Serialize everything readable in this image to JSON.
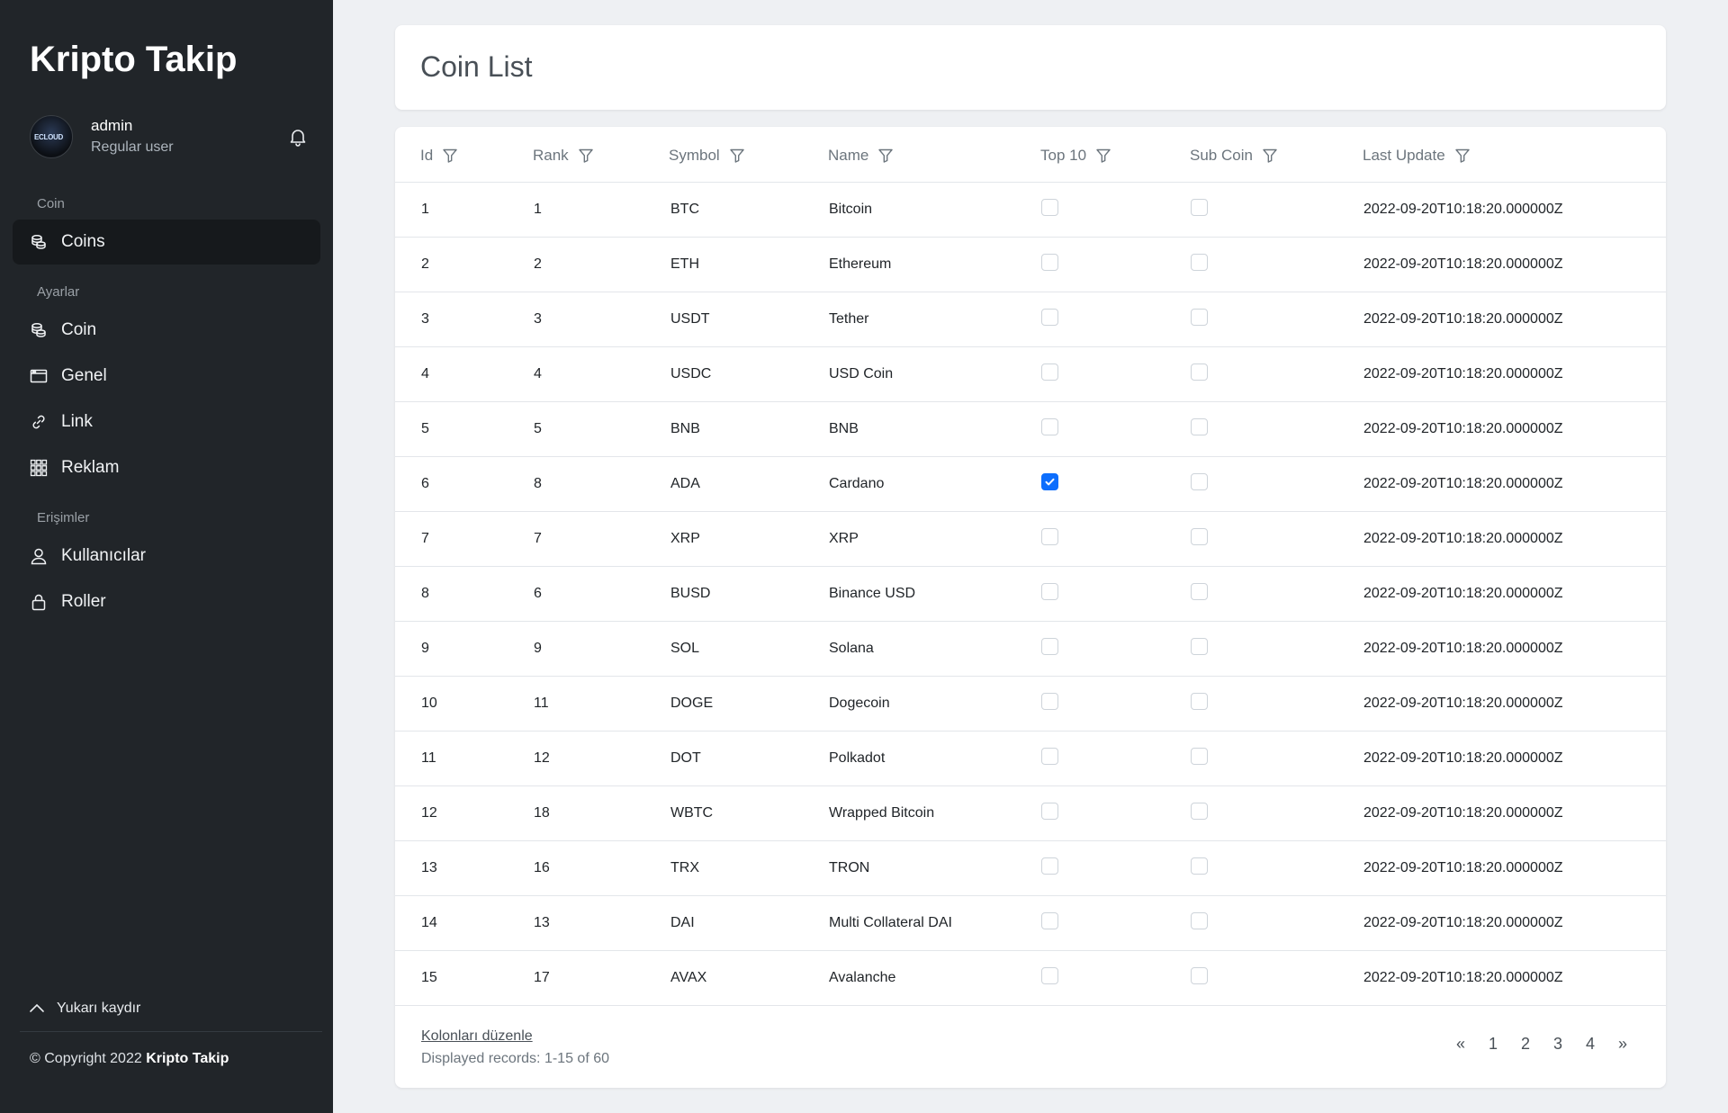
{
  "sidebar": {
    "brand": "Kripto Takip",
    "user": {
      "name": "admin",
      "role": "Regular user",
      "avatar_text": "ECLOUD"
    },
    "sections": [
      {
        "label": "Coin",
        "items": [
          {
            "label": "Coins",
            "icon": "coins-icon",
            "active": true
          }
        ]
      },
      {
        "label": "Ayarlar",
        "items": [
          {
            "label": "Coin",
            "icon": "coins-icon"
          },
          {
            "label": "Genel",
            "icon": "window-icon"
          },
          {
            "label": "Link",
            "icon": "link-icon"
          },
          {
            "label": "Reklam",
            "icon": "grid-icon"
          }
        ]
      },
      {
        "label": "Erişimler",
        "items": [
          {
            "label": "Kullanıcılar",
            "icon": "user-icon"
          },
          {
            "label": "Roller",
            "icon": "lock-icon"
          }
        ]
      }
    ],
    "scroll_up": "Yukarı kaydır",
    "copyright_prefix": "© Copyright 2022",
    "copyright_brand": "Kripto Takip"
  },
  "page": {
    "title": "Coin List"
  },
  "table": {
    "columns": [
      "Id",
      "Rank",
      "Symbol",
      "Name",
      "Top 10",
      "Sub Coin",
      "Last Update"
    ],
    "rows": [
      {
        "id": "1",
        "rank": "1",
        "symbol": "BTC",
        "name": "Bitcoin",
        "top10": false,
        "sub": false,
        "updated": "2022-09-20T10:18:20.000000Z"
      },
      {
        "id": "2",
        "rank": "2",
        "symbol": "ETH",
        "name": "Ethereum",
        "top10": false,
        "sub": false,
        "updated": "2022-09-20T10:18:20.000000Z"
      },
      {
        "id": "3",
        "rank": "3",
        "symbol": "USDT",
        "name": "Tether",
        "top10": false,
        "sub": false,
        "updated": "2022-09-20T10:18:20.000000Z"
      },
      {
        "id": "4",
        "rank": "4",
        "symbol": "USDC",
        "name": "USD Coin",
        "top10": false,
        "sub": false,
        "updated": "2022-09-20T10:18:20.000000Z"
      },
      {
        "id": "5",
        "rank": "5",
        "symbol": "BNB",
        "name": "BNB",
        "top10": false,
        "sub": false,
        "updated": "2022-09-20T10:18:20.000000Z"
      },
      {
        "id": "6",
        "rank": "8",
        "symbol": "ADA",
        "name": "Cardano",
        "top10": true,
        "sub": false,
        "updated": "2022-09-20T10:18:20.000000Z"
      },
      {
        "id": "7",
        "rank": "7",
        "symbol": "XRP",
        "name": "XRP",
        "top10": false,
        "sub": false,
        "updated": "2022-09-20T10:18:20.000000Z"
      },
      {
        "id": "8",
        "rank": "6",
        "symbol": "BUSD",
        "name": "Binance USD",
        "top10": false,
        "sub": false,
        "updated": "2022-09-20T10:18:20.000000Z"
      },
      {
        "id": "9",
        "rank": "9",
        "symbol": "SOL",
        "name": "Solana",
        "top10": false,
        "sub": false,
        "updated": "2022-09-20T10:18:20.000000Z"
      },
      {
        "id": "10",
        "rank": "11",
        "symbol": "DOGE",
        "name": "Dogecoin",
        "top10": false,
        "sub": false,
        "updated": "2022-09-20T10:18:20.000000Z"
      },
      {
        "id": "11",
        "rank": "12",
        "symbol": "DOT",
        "name": "Polkadot",
        "top10": false,
        "sub": false,
        "updated": "2022-09-20T10:18:20.000000Z"
      },
      {
        "id": "12",
        "rank": "18",
        "symbol": "WBTC",
        "name": "Wrapped Bitcoin",
        "top10": false,
        "sub": false,
        "updated": "2022-09-20T10:18:20.000000Z"
      },
      {
        "id": "13",
        "rank": "16",
        "symbol": "TRX",
        "name": "TRON",
        "top10": false,
        "sub": false,
        "updated": "2022-09-20T10:18:20.000000Z"
      },
      {
        "id": "14",
        "rank": "13",
        "symbol": "DAI",
        "name": "Multi Collateral DAI",
        "top10": false,
        "sub": false,
        "updated": "2022-09-20T10:18:20.000000Z"
      },
      {
        "id": "15",
        "rank": "17",
        "symbol": "AVAX",
        "name": "Avalanche",
        "top10": false,
        "sub": false,
        "updated": "2022-09-20T10:18:20.000000Z"
      }
    ],
    "edit_columns": "Kolonları düzenle",
    "records": "Displayed records: 1-15 of 60",
    "pagination": [
      "«",
      "1",
      "2",
      "3",
      "4",
      "»"
    ]
  },
  "colors": {
    "sidebar_bg": "#212529",
    "active_item": "#16191c",
    "checkbox_on": "#0d6efd",
    "page_bg": "#eef0f3"
  }
}
